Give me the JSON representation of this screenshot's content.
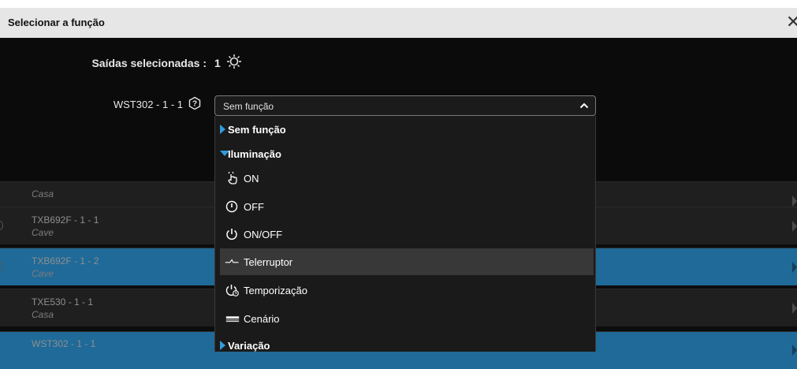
{
  "dialog": {
    "title": "Selecionar a função"
  },
  "selected": {
    "label": "Saídas selecionadas :",
    "count": "1"
  },
  "field": {
    "label": "WST302 - 1 - 1",
    "value": "Sem função"
  },
  "dropdown": {
    "sem_funcao_group": "Sem função",
    "iluminacao_group": "Iluminação",
    "items": [
      "ON",
      "OFF",
      "ON/OFF",
      "Telerruptor",
      "Temporização",
      "Cenário"
    ],
    "variacao_group": "Variação"
  },
  "background_list": [
    {
      "name": "",
      "location": "Casa"
    },
    {
      "name": "TXB692F - 1 - 1",
      "location": "Cave"
    },
    {
      "name": "TXB692F - 1 - 2",
      "location": "Cave"
    },
    {
      "name": "TXE530 - 1 - 1",
      "location": "Casa"
    },
    {
      "name": "WST302 - 1 - 1",
      "location": ""
    }
  ],
  "colors": {
    "accent": "#2f9bdc",
    "selected_row": "#1f6a98",
    "highlight": "#383838"
  }
}
